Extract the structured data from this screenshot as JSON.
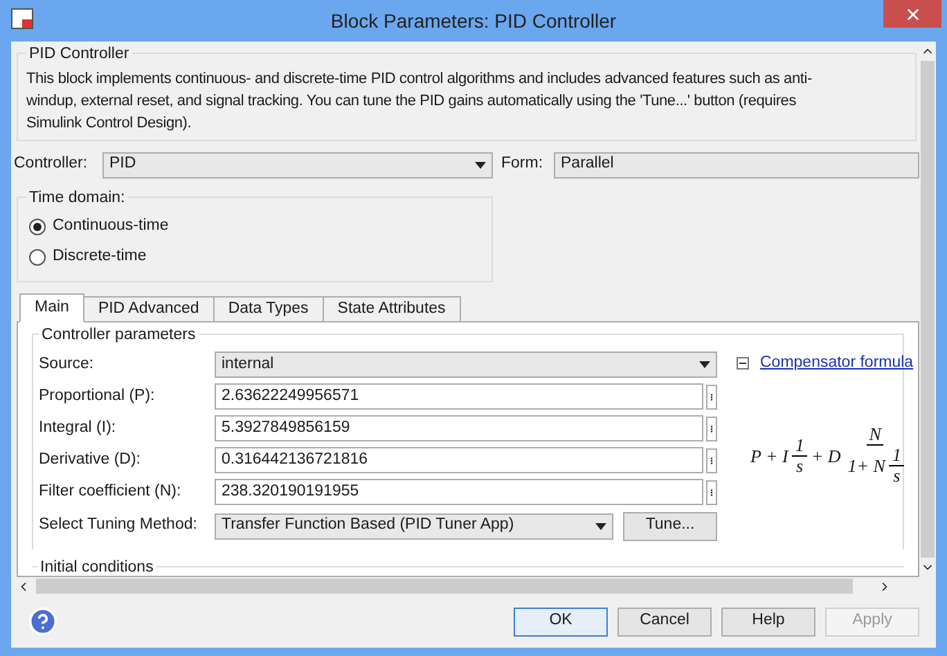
{
  "window": {
    "title": "Block Parameters: PID Controller"
  },
  "description_group": {
    "title": "PID Controller",
    "lines": [
      "This block implements continuous- and discrete-time PID control algorithms and includes advanced features such as anti-",
      "windup, external reset, and signal tracking. You can tune the PID gains automatically using the 'Tune...' button (requires",
      "Simulink Control Design)."
    ]
  },
  "controller": {
    "label": "Controller:",
    "value": "PID"
  },
  "form": {
    "label": "Form:",
    "value": "Parallel"
  },
  "time_domain": {
    "title": "Time domain:",
    "options": [
      {
        "label": "Continuous-time",
        "selected": true
      },
      {
        "label": "Discrete-time",
        "selected": false
      }
    ]
  },
  "tabs": [
    {
      "label": "Main",
      "selected": true
    },
    {
      "label": "PID Advanced",
      "selected": false
    },
    {
      "label": "Data Types",
      "selected": false
    },
    {
      "label": "State Attributes",
      "selected": false
    }
  ],
  "controller_parameters": {
    "title": "Controller parameters",
    "rows": [
      {
        "kind": "dropdown",
        "label": "Source:",
        "value": "internal"
      },
      {
        "kind": "field",
        "label": "Proportional (P):",
        "value": "2.63622249956571"
      },
      {
        "kind": "field",
        "label": "Integral (I):",
        "value": "5.3927849856159"
      },
      {
        "kind": "field",
        "label": "Derivative (D):",
        "value": "0.316442136721816"
      },
      {
        "kind": "field",
        "label": "Filter coefficient (N):",
        "value": "238.320190191955"
      },
      {
        "kind": "tuning",
        "label": "Select Tuning Method:",
        "value": "Transfer Function Based (PID Tuner App)",
        "button": "Tune..."
      }
    ],
    "compensator": {
      "expanded": true,
      "link": "Compensator formula",
      "formula": [
        {
          "kind": "text",
          "text": "P + I"
        },
        {
          "kind": "frac",
          "num": "1",
          "den": [
            {
              "kind": "text",
              "text": "s"
            }
          ]
        },
        {
          "kind": "text",
          "text": "+ D"
        },
        {
          "kind": "frac",
          "num": "N",
          "den": [
            {
              "kind": "text",
              "text": "1+ N"
            },
            {
              "kind": "frac",
              "num": "1",
              "den": [
                {
                  "kind": "text",
                  "text": "s"
                }
              ]
            }
          ]
        }
      ]
    }
  },
  "initial_conditions": {
    "title": "Initial conditions"
  },
  "buttons": [
    {
      "label": "OK",
      "default": true,
      "disabled": false
    },
    {
      "label": "Cancel",
      "default": false,
      "disabled": false
    },
    {
      "label": "Help",
      "default": false,
      "disabled": false
    },
    {
      "label": "Apply",
      "default": false,
      "disabled": true
    }
  ]
}
